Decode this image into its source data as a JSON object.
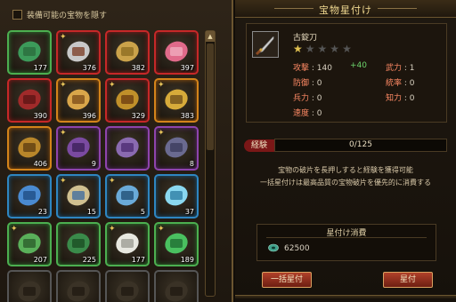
{
  "inventory": {
    "hide_equippable_label": "装備可能の宝物を隠す",
    "items": [
      {
        "count": "177",
        "rarity": "green",
        "icon": "jade-scroll-icon",
        "badge": ""
      },
      {
        "count": "376",
        "rarity": "red",
        "icon": "crossed-blades-icon",
        "badge": "✦"
      },
      {
        "count": "382",
        "rarity": "red",
        "icon": "golden-map-icon",
        "badge": ""
      },
      {
        "count": "397",
        "rarity": "red",
        "icon": "pink-peony-icon",
        "badge": ""
      },
      {
        "count": "390",
        "rarity": "red",
        "icon": "red-book-icon",
        "badge": ""
      },
      {
        "count": "396",
        "rarity": "orange",
        "icon": "golden-bow-icon",
        "badge": "✦"
      },
      {
        "count": "329",
        "rarity": "red",
        "icon": "golden-tome-icon",
        "badge": "✦"
      },
      {
        "count": "383",
        "rarity": "orange",
        "icon": "golden-armor-icon",
        "badge": "✦"
      },
      {
        "count": "406",
        "rarity": "orange",
        "icon": "bronze-coin-icon",
        "badge": ""
      },
      {
        "count": "9",
        "rarity": "purple",
        "icon": "purple-book-icon",
        "badge": "✦"
      },
      {
        "count": "",
        "rarity": "purple",
        "icon": "purple-vest-icon",
        "badge": ""
      },
      {
        "count": "8",
        "rarity": "purple",
        "icon": "purple-vase-icon",
        "badge": "✦"
      },
      {
        "count": "23",
        "rarity": "blue",
        "icon": "blue-crossbow-icon",
        "badge": ""
      },
      {
        "count": "15",
        "rarity": "blue",
        "icon": "blue-scroll-icon",
        "badge": "✦"
      },
      {
        "count": "5",
        "rarity": "blue",
        "icon": "blue-dagger-icon",
        "badge": "✦"
      },
      {
        "count": "37",
        "rarity": "blue",
        "icon": "crystal-orb-icon",
        "badge": ""
      },
      {
        "count": "207",
        "rarity": "green",
        "icon": "green-swords-icon",
        "badge": "✦"
      },
      {
        "count": "225",
        "rarity": "green",
        "icon": "green-book-icon",
        "badge": ""
      },
      {
        "count": "177",
        "rarity": "green",
        "icon": "white-robe-icon",
        "badge": "✦"
      },
      {
        "count": "189",
        "rarity": "green",
        "icon": "green-coral-icon",
        "badge": "✦"
      },
      {
        "count": "",
        "rarity": "none",
        "icon": "blank-slot-icon",
        "badge": ""
      },
      {
        "count": "",
        "rarity": "none",
        "icon": "blank-slot-icon",
        "badge": ""
      },
      {
        "count": "",
        "rarity": "none",
        "icon": "blank-slot-icon",
        "badge": ""
      },
      {
        "count": "",
        "rarity": "none",
        "icon": "blank-slot-icon",
        "badge": ""
      }
    ]
  },
  "panel": {
    "title": "宝物星付け",
    "item": {
      "name": "古錠刀",
      "stars_total": 5,
      "stars_filled": 1,
      "stats": {
        "attack_label": "攻撃",
        "attack": ": 140",
        "attack_bonus": "+40",
        "defense_label": "防御",
        "defense": ": 0",
        "troops_label": "兵力",
        "troops": ": 0",
        "speed_label": "速度",
        "speed": ": 0",
        "force_label": "武力",
        "force": ": 1",
        "command_label": "統率",
        "command": ": 0",
        "intellect_label": "知力",
        "intellect": ": 0"
      }
    },
    "exp": {
      "label": "経験",
      "text": "0/125",
      "progress": 0
    },
    "desc_line1": "宝物の破片を長押しすると経験を獲得可能",
    "desc_line2": "一括星付けは最高品質の宝物破片を優先的に消費する",
    "cost": {
      "title": "星付け消費",
      "value": "62500",
      "icon": "jade-coin-icon"
    },
    "buttons": {
      "bulk": "一括星付",
      "single": "星付"
    }
  }
}
